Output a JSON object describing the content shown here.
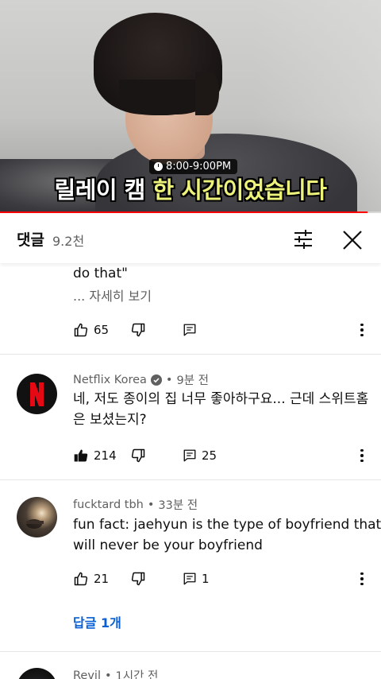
{
  "video": {
    "timer_text": "8:00-9:00PM",
    "caption_white": "릴레이 캠 ",
    "caption_yellow": "한 시간이었습니다",
    "progress": 0.965,
    "colors": {
      "progress": "#ff0000",
      "caption_highlight": "#ecf27a"
    }
  },
  "header": {
    "title": "댓글",
    "count": "9.2천",
    "filter_icon": "sliders-icon",
    "close_icon": "close-icon"
  },
  "comments": [
    {
      "text_lines": [
        "do that\""
      ],
      "more_label": "... 자세히 보기",
      "likes": "65",
      "replies": ""
    },
    {
      "author": "Netflix Korea",
      "verified": true,
      "time": "9분 전",
      "text_lines": [
        "네, 저도 종이의 집 너무 좋아하구요... 근데 스위트홈",
        "은 보셨는지?"
      ],
      "likes": "214",
      "liked": true,
      "replies": "25"
    },
    {
      "author": "fucktard tbh",
      "time": "33분 전",
      "text_lines": [
        "fun fact: jaehyun is the type of boyfriend that",
        "will never be your boyfriend"
      ],
      "likes": "21",
      "replies": "1",
      "replies_link": "답글 1개"
    },
    {
      "author": "Revil",
      "time": "1시간 전"
    }
  ],
  "colors": {
    "link": "#065fd4",
    "netflix_red": "#e50914",
    "meta_gray": "#606060"
  }
}
